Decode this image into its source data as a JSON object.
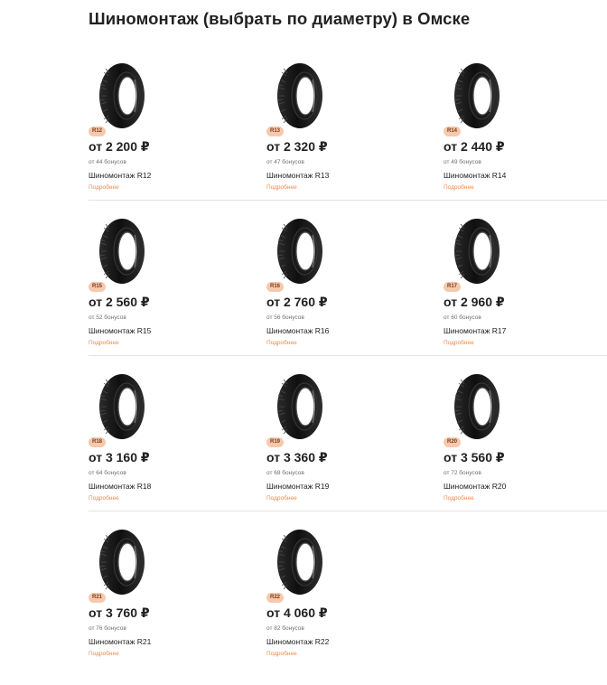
{
  "page": {
    "title": "Шиномонтаж (выбрать по диаметру) в Омске"
  },
  "colors": {
    "badge_bg": "#f6c9ad",
    "badge_text": "#7a3d1a",
    "link": "#f08a4b",
    "text": "#222222",
    "muted": "#6f6f6f",
    "divider": "#e3e3e3"
  },
  "cards": [
    {
      "size": "R12",
      "price": "от 2 200 ₽",
      "bonus": "от 44 бонусов",
      "name": "Шиномонтаж R12",
      "more": "Подробнее",
      "icon": "tire-icon"
    },
    {
      "size": "R13",
      "price": "от 2 320 ₽",
      "bonus": "от 47 бонусов",
      "name": "Шиномонтаж R13",
      "more": "Подробнее",
      "icon": "tire-icon"
    },
    {
      "size": "R14",
      "price": "от 2 440 ₽",
      "bonus": "от 49 бонусов",
      "name": "Шиномонтаж R14",
      "more": "Подробнее",
      "icon": "tire-icon"
    },
    {
      "size": "R15",
      "price": "от 2 560 ₽",
      "bonus": "от 52 бонусов",
      "name": "Шиномонтаж R15",
      "more": "Подробнее",
      "icon": "tire-icon"
    },
    {
      "size": "R16",
      "price": "от 2 760 ₽",
      "bonus": "от 56 бонусов",
      "name": "Шиномонтаж R16",
      "more": "Подробнее",
      "icon": "tire-icon"
    },
    {
      "size": "R17",
      "price": "от 2 960 ₽",
      "bonus": "от 60 бонусов",
      "name": "Шиномонтаж R17",
      "more": "Подробнее",
      "icon": "tire-icon"
    },
    {
      "size": "R18",
      "price": "от 3 160 ₽",
      "bonus": "от 64 бонусов",
      "name": "Шиномонтаж R18",
      "more": "Подробнее",
      "icon": "tire-icon"
    },
    {
      "size": "R19",
      "price": "от 3 360 ₽",
      "bonus": "от 68 бонусов",
      "name": "Шиномонтаж R19",
      "more": "Подробнее",
      "icon": "tire-icon"
    },
    {
      "size": "R20",
      "price": "от 3 560 ₽",
      "bonus": "от 72 бонусов",
      "name": "Шиномонтаж R20",
      "more": "Подробнее",
      "icon": "tire-icon"
    },
    {
      "size": "R21",
      "price": "от 3 760 ₽",
      "bonus": "от 76 бонусов",
      "name": "Шиномонтаж R21",
      "more": "Подробнее",
      "icon": "tire-icon"
    },
    {
      "size": "R22",
      "price": "от 4 060 ₽",
      "bonus": "от 82 бонусов",
      "name": "Шиномонтаж R22",
      "more": "Подробнее",
      "icon": "tire-icon"
    }
  ]
}
